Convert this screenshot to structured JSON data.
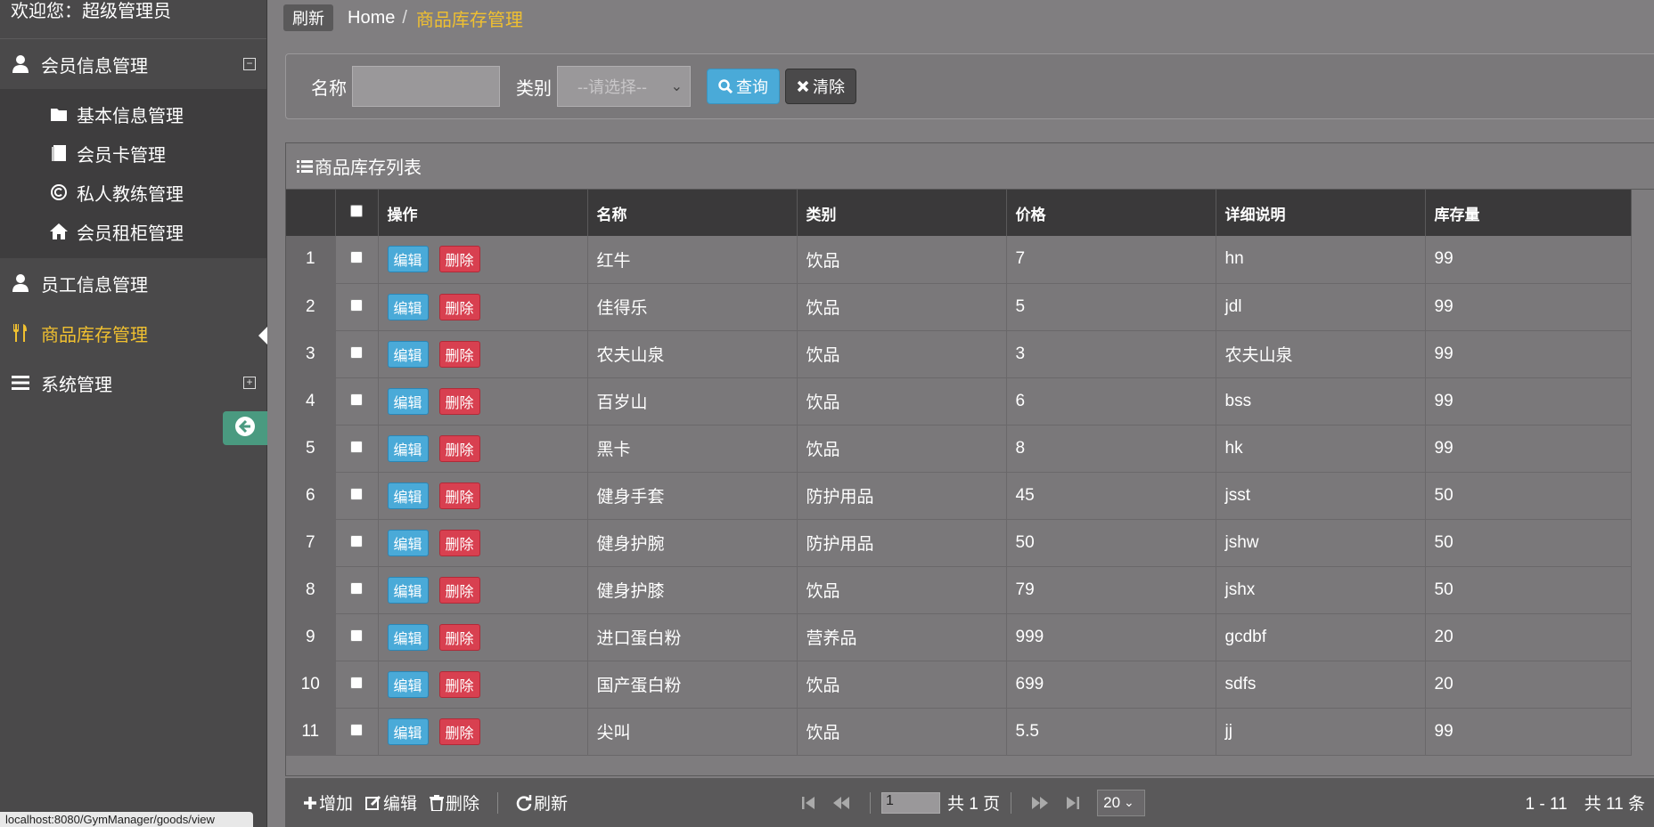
{
  "sidebar": {
    "welcome": "欢迎您：超级管理员",
    "menus": [
      {
        "label": "会员信息管理",
        "toggle": "⊟"
      },
      {
        "label": "员工信息管理"
      },
      {
        "label": "商品库存管理"
      },
      {
        "label": "系统管理",
        "toggle": "⊞"
      }
    ],
    "submenu": [
      {
        "label": "基本信息管理"
      },
      {
        "label": "会员卡管理"
      },
      {
        "label": "私人教练管理"
      },
      {
        "label": "会员租柜管理"
      }
    ],
    "status_url": "localhost:8080/GymManager/goods/view"
  },
  "topbar": {
    "refresh": "刷新",
    "home": "Home",
    "sep": "/",
    "current": "商品库存管理"
  },
  "search": {
    "name_label": "名称",
    "category_label": "类别",
    "category_placeholder": "--请选择--",
    "query_label": "查询",
    "clear_label": "清除"
  },
  "table": {
    "title": "商品库存列表",
    "headers": [
      "操作",
      "名称",
      "类别",
      "价格",
      "详细说明",
      "库存量"
    ],
    "edit_label": "编辑",
    "delete_label": "删除",
    "rows": [
      {
        "n": "1",
        "name": "红牛",
        "cat": "饮品",
        "price": "7",
        "desc": "hn",
        "stock": "99"
      },
      {
        "n": "2",
        "name": "佳得乐",
        "cat": "饮品",
        "price": "5",
        "desc": "jdl",
        "stock": "99"
      },
      {
        "n": "3",
        "name": "农夫山泉",
        "cat": "饮品",
        "price": "3",
        "desc": "农夫山泉",
        "stock": "99"
      },
      {
        "n": "4",
        "name": "百岁山",
        "cat": "饮品",
        "price": "6",
        "desc": "bss",
        "stock": "99"
      },
      {
        "n": "5",
        "name": "黑卡",
        "cat": "饮品",
        "price": "8",
        "desc": "hk",
        "stock": "99"
      },
      {
        "n": "6",
        "name": "健身手套",
        "cat": "防护用品",
        "price": "45",
        "desc": "jsst",
        "stock": "50"
      },
      {
        "n": "7",
        "name": "健身护腕",
        "cat": "防护用品",
        "price": "50",
        "desc": "jshw",
        "stock": "50"
      },
      {
        "n": "8",
        "name": "健身护膝",
        "cat": "饮品",
        "price": "79",
        "desc": "jshx",
        "stock": "50"
      },
      {
        "n": "9",
        "name": "进口蛋白粉",
        "cat": "营养品",
        "price": "999",
        "desc": "gcdbf",
        "stock": "20"
      },
      {
        "n": "10",
        "name": "国产蛋白粉",
        "cat": "饮品",
        "price": "699",
        "desc": "sdfs",
        "stock": "20"
      },
      {
        "n": "11",
        "name": "尖叫",
        "cat": "饮品",
        "price": "5.5",
        "desc": "jj",
        "stock": "99"
      }
    ]
  },
  "footer": {
    "add": "增加",
    "edit": "编辑",
    "delete": "删除",
    "refresh": "刷新",
    "page_value": "1",
    "total_pages": "共 1 页",
    "page_size": "20",
    "range": "1 - 11　共 11 条"
  },
  "colors": {
    "accent_yellow": "#f0c030",
    "primary_blue": "#4aaad8",
    "danger_red": "#d84050"
  }
}
